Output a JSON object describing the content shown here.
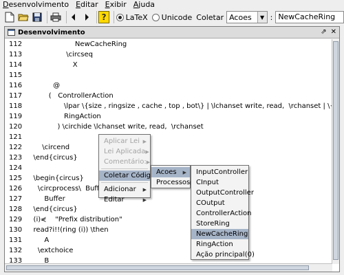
{
  "menubar": {
    "items": [
      {
        "label": "Desenvolvimento"
      },
      {
        "label": "Editar"
      },
      {
        "label": "Exibir"
      },
      {
        "label": "Ajuda"
      }
    ]
  },
  "toolbar": {
    "buttons": [
      "new-file-icon",
      "open-folder-icon",
      "save-icon",
      "print-icon",
      "back-arrow-icon",
      "forward-arrow-icon",
      "help-icon"
    ],
    "help_label": "?",
    "radio_latex": "LaTeX",
    "radio_unicode": "Unicode",
    "latex_selected": true,
    "coletar_label": "Coletar",
    "combo_value": "Acoes",
    "separator": ":",
    "field_value": "NewCacheRing"
  },
  "window": {
    "title": "Desenvolvimento",
    "restore_glyph": "⇗",
    "close_glyph": "✕"
  },
  "editor": {
    "lines": [
      {
        "num": "112",
        "text": "                      NewCacheRing"
      },
      {
        "num": "113",
        "text": "                  \\circseq"
      },
      {
        "num": "114",
        "text": "                     X"
      },
      {
        "num": "115",
        "text": ""
      },
      {
        "num": "116",
        "text": "            @"
      },
      {
        "num": "117",
        "text": "          (   ControllerAction"
      },
      {
        "num": "118",
        "text": "                 \\lpar \\{size , ringsize , cache , top , bot\\} | \\lchanset write, read,  \\rchanset | \\{ring\\} \\rpar"
      },
      {
        "num": "119",
        "text": "                 RingAction"
      },
      {
        "num": "120",
        "text": "              ) \\circhide \\lchanset write, read,  \\rchanset"
      },
      {
        "num": "121",
        "text": ""
      },
      {
        "num": "122",
        "text": "       \\circend"
      },
      {
        "num": "123",
        "text": "   \\end{circus}"
      },
      {
        "num": "124",
        "text": ""
      },
      {
        "num": "125",
        "text": "   \\begin{circus}"
      },
      {
        "num": "126",
        "text": "     \\circprocess\\  Buffe"
      },
      {
        "num": "127",
        "text": "        Buffer"
      },
      {
        "num": "128",
        "text": "   \\end{circus}"
      },
      {
        "num": "129",
        "text": "   (i)⋞    \"Prefix distribution\""
      },
      {
        "num": "130",
        "text": "   read?i!!(ring (i)) \\then"
      },
      {
        "num": "131",
        "text": "        A"
      },
      {
        "num": "132",
        "text": "     \\extchoice"
      },
      {
        "num": "133",
        "text": "        B"
      }
    ]
  },
  "context_menu": {
    "items": [
      {
        "label": "Aplicar Lei",
        "enabled": false,
        "submenu": true
      },
      {
        "label": "Lei Aplicada",
        "enabled": false,
        "submenu": true
      },
      {
        "label": "Comentário:",
        "enabled": false,
        "submenu": true
      },
      {
        "label": "Coletar Código",
        "enabled": true,
        "submenu": true,
        "active": true
      },
      {
        "label": "Adicionar",
        "enabled": true,
        "submenu": true
      },
      {
        "label": "Editar",
        "enabled": true,
        "submenu": true
      }
    ]
  },
  "submenu_coletar": {
    "items": [
      {
        "label": "Acoes",
        "active": true
      },
      {
        "label": "Processos",
        "active": false
      }
    ]
  },
  "submenu_acoes": {
    "items": [
      {
        "label": "InputController",
        "active": false
      },
      {
        "label": "CInput",
        "active": false
      },
      {
        "label": "OutputController",
        "active": false
      },
      {
        "label": "COutput",
        "active": false
      },
      {
        "label": "ControllerAction",
        "active": false
      },
      {
        "label": "StoreRing",
        "active": false
      },
      {
        "label": "NewCacheRing",
        "active": true
      },
      {
        "label": "RingAction",
        "active": false
      },
      {
        "label": "Ação principal(0)",
        "active": false
      }
    ]
  }
}
